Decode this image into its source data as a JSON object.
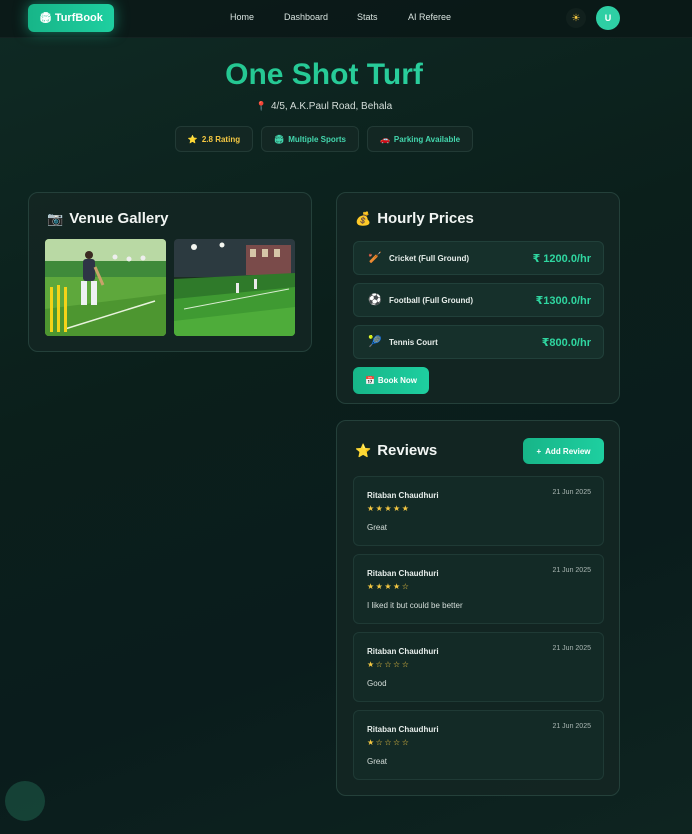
{
  "nav": {
    "brand": "TurfBook",
    "brand_icon": "🏟",
    "links": [
      "Home",
      "Dashboard",
      "Stats",
      "AI Referee"
    ],
    "theme_icon": "☀",
    "avatar_letter": "U"
  },
  "venue": {
    "name": "One Shot Turf",
    "address": "4/5, A.K.Paul Road, Behala",
    "pin_icon": "📍",
    "badges": [
      {
        "icon": "⭐",
        "label": "2.8 Rating"
      },
      {
        "icon": "🏟",
        "label": "Multiple Sports"
      },
      {
        "icon": "🚗",
        "label": "Parking Available"
      }
    ]
  },
  "gallery": {
    "icon": "📷",
    "title": "Venue Gallery"
  },
  "prices": {
    "icon": "💰",
    "title": "Hourly Prices",
    "items": [
      {
        "icon": "🏏",
        "sport": "Cricket (Full Ground)",
        "price": "₹ 1200.0/hr"
      },
      {
        "icon": "⚽",
        "sport": "Football (Full Ground)",
        "price": "₹1300.0/hr"
      },
      {
        "icon": "🎾",
        "sport": "Tennis Court",
        "price": "₹800.0/hr"
      }
    ],
    "book_icon": "📅",
    "book_label": "Book Now"
  },
  "reviews": {
    "icon": "⭐",
    "title": "Reviews",
    "add_icon": "+",
    "add_label": "Add Review",
    "items": [
      {
        "name": "Ritaban Chaudhuri",
        "date": "21 Jun 2025",
        "stars": "★★★★★",
        "text": "Great"
      },
      {
        "name": "Ritaban Chaudhuri",
        "date": "21 Jun 2025",
        "stars": "★★★★☆",
        "text": "I liked it but could be better"
      },
      {
        "name": "Ritaban Chaudhuri",
        "date": "21 Jun 2025",
        "stars": "★☆☆☆☆",
        "text": "Good"
      },
      {
        "name": "Ritaban Chaudhuri",
        "date": "21 Jun 2025",
        "stars": "★☆☆☆☆",
        "text": "Great"
      }
    ]
  },
  "colors": {
    "accent": "#1ecfa0",
    "star": "#f5c842",
    "background": "#0b1f1b"
  }
}
